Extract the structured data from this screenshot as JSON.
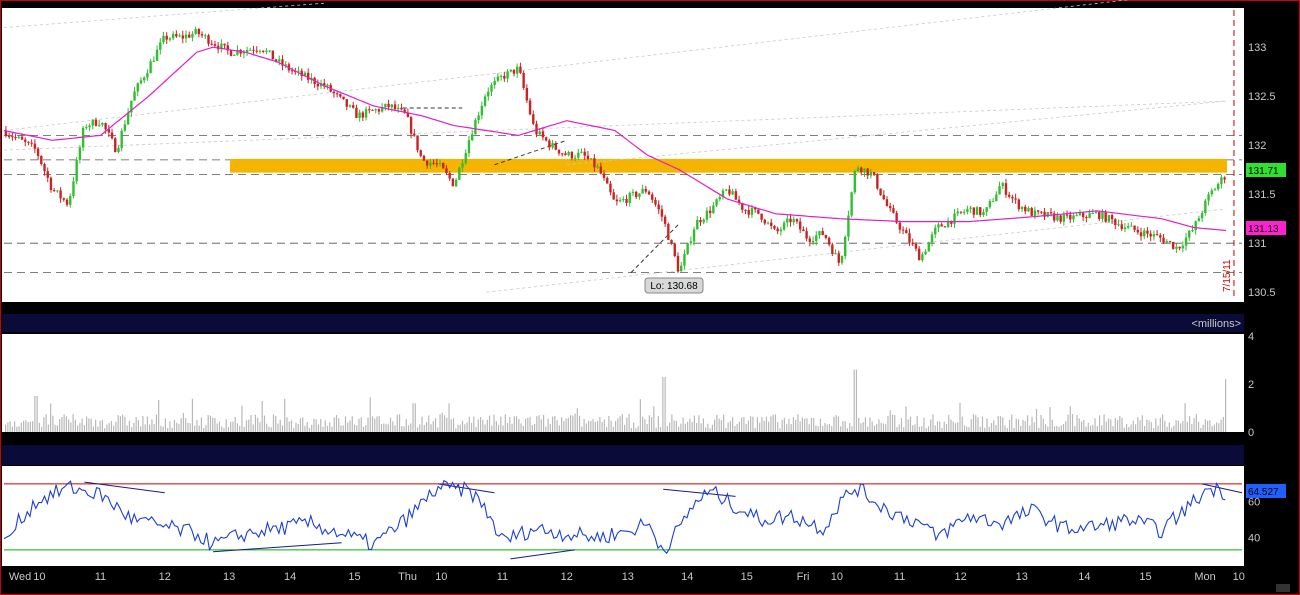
{
  "chart_data": [
    {
      "type": "candlestick",
      "panel": "price",
      "ylim": [
        130.4,
        133.4
      ],
      "y_ticks": [
        "133",
        "132.5",
        "132",
        "131.5",
        "131",
        "130.5"
      ],
      "date_marker": "7/15/11",
      "low_label": "Lo: 130.68",
      "last_price_label": "131.71",
      "moving_average_label": "131.13",
      "resistance_zone": [
        131.72,
        131.86
      ],
      "horizontal_levels": [
        132.1,
        131.85,
        131.7,
        131.0,
        130.7
      ],
      "price_path": [
        [
          0,
          132.15
        ],
        [
          2,
          131.95
        ],
        [
          3,
          131.55
        ],
        [
          4,
          131.4
        ],
        [
          5,
          132.2
        ],
        [
          6,
          132.25
        ],
        [
          7,
          131.95
        ],
        [
          8,
          132.5
        ],
        [
          9,
          132.8
        ],
        [
          10,
          133.1
        ],
        [
          11,
          133.1
        ],
        [
          12,
          133.15
        ],
        [
          14,
          132.95
        ],
        [
          16,
          133.0
        ],
        [
          17,
          132.85
        ],
        [
          18,
          132.75
        ],
        [
          20,
          132.6
        ],
        [
          22,
          132.3
        ],
        [
          24,
          132.4
        ],
        [
          25,
          132.3
        ],
        [
          26,
          131.85
        ],
        [
          27,
          131.8
        ],
        [
          28,
          131.6
        ],
        [
          29,
          132.1
        ],
        [
          30,
          132.55
        ],
        [
          31,
          132.7
        ],
        [
          32,
          132.78
        ],
        [
          33,
          132.15
        ],
        [
          34,
          132.0
        ],
        [
          35,
          131.9
        ],
        [
          36,
          131.9
        ],
        [
          37,
          131.75
        ],
        [
          38,
          131.4
        ],
        [
          40,
          131.55
        ],
        [
          41,
          131.25
        ],
        [
          42,
          130.7
        ],
        [
          43,
          131.2
        ],
        [
          44,
          131.35
        ],
        [
          45,
          131.55
        ],
        [
          46,
          131.35
        ],
        [
          47,
          131.3
        ],
        [
          48,
          131.1
        ],
        [
          49,
          131.25
        ],
        [
          50,
          131.05
        ],
        [
          51,
          131.1
        ],
        [
          52,
          130.78
        ],
        [
          53,
          131.8
        ],
        [
          54,
          131.7
        ],
        [
          55,
          131.35
        ],
        [
          56,
          131.1
        ],
        [
          57,
          130.85
        ],
        [
          58,
          131.15
        ],
        [
          60,
          131.35
        ],
        [
          61,
          131.3
        ],
        [
          62,
          131.6
        ],
        [
          63,
          131.4
        ],
        [
          64,
          131.3
        ],
        [
          66,
          131.25
        ],
        [
          68,
          131.3
        ],
        [
          70,
          131.15
        ],
        [
          72,
          131.05
        ],
        [
          73,
          130.95
        ],
        [
          74,
          131.15
        ],
        [
          75,
          131.5
        ],
        [
          76,
          131.7
        ]
      ],
      "moving_average": [
        [
          0,
          132.15
        ],
        [
          3,
          132.05
        ],
        [
          6,
          132.1
        ],
        [
          9,
          132.5
        ],
        [
          11,
          132.8
        ],
        [
          12,
          132.95
        ],
        [
          13,
          133.0
        ],
        [
          15,
          132.95
        ],
        [
          17,
          132.85
        ],
        [
          20,
          132.6
        ],
        [
          23,
          132.4
        ],
        [
          26,
          132.3
        ],
        [
          28,
          132.2
        ],
        [
          30,
          132.15
        ],
        [
          32,
          132.1
        ],
        [
          35,
          132.25
        ],
        [
          38,
          132.15
        ],
        [
          40,
          131.9
        ],
        [
          42,
          131.75
        ],
        [
          45,
          131.45
        ],
        [
          48,
          131.3
        ],
        [
          52,
          131.25
        ],
        [
          56,
          131.22
        ],
        [
          60,
          131.22
        ],
        [
          64,
          131.27
        ],
        [
          68,
          131.33
        ],
        [
          72,
          131.25
        ],
        [
          74,
          131.16
        ],
        [
          76,
          131.13
        ]
      ]
    },
    {
      "type": "bar",
      "panel": "volume",
      "unit_label": "<millions>",
      "ylim": [
        0,
        4
      ],
      "y_ticks": [
        "4",
        "2",
        "0"
      ],
      "spikes": [
        [
          2,
          1.5
        ],
        [
          25.5,
          1.2
        ],
        [
          41,
          2.3
        ],
        [
          53,
          2.6
        ],
        [
          76,
          2.2
        ]
      ]
    },
    {
      "type": "line",
      "panel": "oscillator",
      "ylim": [
        24,
        80
      ],
      "y_ticks": [
        "60",
        "40"
      ],
      "overbought": 70,
      "oversold": 33,
      "last_value_label": "64.527",
      "path": [
        [
          0,
          36
        ],
        [
          1,
          50
        ],
        [
          2,
          60
        ],
        [
          4,
          68
        ],
        [
          6,
          64
        ],
        [
          8,
          50
        ],
        [
          10,
          46
        ],
        [
          12,
          42
        ],
        [
          13,
          36
        ],
        [
          15,
          42
        ],
        [
          17,
          45
        ],
        [
          19,
          48
        ],
        [
          21,
          42
        ],
        [
          23,
          36
        ],
        [
          25,
          50
        ],
        [
          27,
          68
        ],
        [
          29,
          66
        ],
        [
          30,
          55
        ],
        [
          31,
          38
        ],
        [
          33,
          45
        ],
        [
          35,
          42
        ],
        [
          37,
          40
        ],
        [
          39,
          44
        ],
        [
          40,
          48
        ],
        [
          41,
          33
        ],
        [
          42,
          45
        ],
        [
          43,
          60
        ],
        [
          44,
          66
        ],
        [
          45,
          60
        ],
        [
          47,
          50
        ],
        [
          49,
          52
        ],
        [
          51,
          45
        ],
        [
          52,
          60
        ],
        [
          53,
          68
        ],
        [
          55,
          55
        ],
        [
          57,
          48
        ],
        [
          58,
          40
        ],
        [
          60,
          52
        ],
        [
          62,
          48
        ],
        [
          64,
          55
        ],
        [
          66,
          45
        ],
        [
          68,
          46
        ],
        [
          70,
          50
        ],
        [
          72,
          44
        ],
        [
          73,
          52
        ],
        [
          75,
          68
        ],
        [
          76,
          65
        ]
      ]
    }
  ],
  "x_axis": {
    "range": [
      0,
      77
    ],
    "labels": [
      {
        "t": 1,
        "text": "Wed"
      },
      {
        "t": 2.2,
        "text": "10"
      },
      {
        "t": 6,
        "text": "11"
      },
      {
        "t": 10,
        "text": "12"
      },
      {
        "t": 14,
        "text": "13"
      },
      {
        "t": 17.8,
        "text": "14"
      },
      {
        "t": 21.8,
        "text": "15"
      },
      {
        "t": 25.1,
        "text": "Thu"
      },
      {
        "t": 27.2,
        "text": "10"
      },
      {
        "t": 31,
        "text": "11"
      },
      {
        "t": 35,
        "text": "12"
      },
      {
        "t": 38.8,
        "text": "13"
      },
      {
        "t": 42.5,
        "text": "14"
      },
      {
        "t": 46.2,
        "text": "15"
      },
      {
        "t": 49.7,
        "text": "Fri"
      },
      {
        "t": 51.8,
        "text": "10"
      },
      {
        "t": 55.7,
        "text": "11"
      },
      {
        "t": 59.5,
        "text": "12"
      },
      {
        "t": 63.3,
        "text": "13"
      },
      {
        "t": 67.2,
        "text": "14"
      },
      {
        "t": 71,
        "text": "15"
      },
      {
        "t": 74.7,
        "text": "Mon"
      },
      {
        "t": 76.8,
        "text": "10"
      }
    ]
  },
  "colors": {
    "background": "#ffffff",
    "frame": "#000000",
    "border": "#cc0000",
    "bull_candle": "#2fbf2f",
    "bear_candle": "#cc2222",
    "moving_average": "#e020c8",
    "resistance_zone": "#f5b400",
    "volume": "#b8b8b8",
    "oscillator": "#1a3fd6",
    "overbought_line": "#cc0000",
    "oversold_line": "#00b000",
    "separator": "#0b0b3a",
    "price_label": "#30e030",
    "ma_label": "#ff20d0",
    "osc_label": "#2060ff"
  }
}
